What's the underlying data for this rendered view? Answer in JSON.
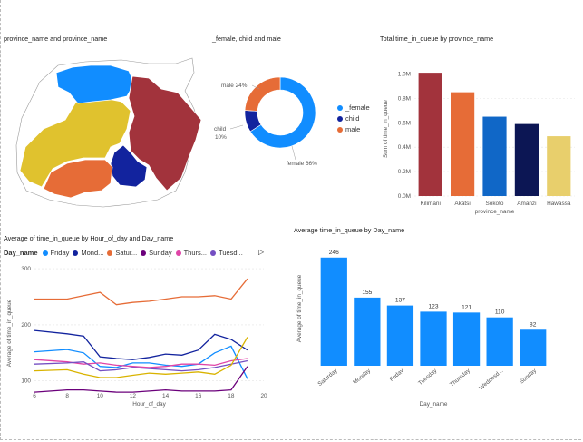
{
  "map": {
    "title": "province_name and province_name",
    "regions": [
      {
        "name": "Sokoto",
        "color": "#118DFF"
      },
      {
        "name": "Kilimani",
        "color": "#A2333C"
      },
      {
        "name": "Akatsi",
        "color": "#E66C37"
      },
      {
        "name": "Amanzi",
        "color": "#12239E"
      },
      {
        "name": "Hawassa",
        "color": "#E0C22E"
      }
    ]
  },
  "donut": {
    "title": "_female, child and male",
    "slices": [
      {
        "name": "_female",
        "value": 66,
        "label": "female 66%",
        "color": "#118DFF"
      },
      {
        "name": "child",
        "value": 10,
        "label": "child",
        "sublabel": "10%",
        "color": "#12239E"
      },
      {
        "name": "male",
        "value": 24,
        "label": "male 24%",
        "color": "#E66C37"
      }
    ],
    "legend": [
      "_female",
      "child",
      "male"
    ]
  },
  "bar_province": {
    "title": "Total time_in_queue by province_name",
    "xlabel": "province_name",
    "ylabel": "Sum of time_in_queue",
    "chart_data": {
      "type": "bar",
      "categories": [
        "Kilimani",
        "Akatsi",
        "Sokoto",
        "Amanzi",
        "Hawassa"
      ],
      "values": [
        1.01,
        0.85,
        0.65,
        0.59,
        0.49
      ],
      "colors": [
        "#A2333C",
        "#E66C37",
        "#1067C7",
        "#0C1654",
        "#E8CF6C"
      ],
      "ticks": [
        "0.0M",
        "0.2M",
        "0.4M",
        "0.6M",
        "0.8M",
        "1.0M"
      ],
      "ylim": [
        0,
        1.1
      ]
    }
  },
  "line_hour": {
    "title": "Average of time_in_queue by Hour_of_day and Day_name",
    "legend_title": "Day_name",
    "legend": [
      {
        "name": "Friday",
        "color": "#118DFF"
      },
      {
        "name": "Mond...",
        "color": "#12239E"
      },
      {
        "name": "Satur...",
        "color": "#E66C37"
      },
      {
        "name": "Sunday",
        "color": "#6B007B"
      },
      {
        "name": "Thurs...",
        "color": "#E044A7"
      },
      {
        "name": "Tuesd...",
        "color": "#744EC2"
      }
    ],
    "xlabel": "Hour_of_day",
    "ylabel": "Average of time_in_queue",
    "xticks": [
      "6",
      "8",
      "10",
      "12",
      "14",
      "16",
      "18",
      "20"
    ],
    "yticks": [
      "100",
      "200",
      "300"
    ],
    "chart_data": {
      "type": "line",
      "x": [
        6,
        8,
        9,
        10,
        11,
        12,
        13,
        14,
        15,
        16,
        17,
        18,
        19
      ],
      "ylim": [
        85,
        305
      ],
      "xlim": [
        6,
        20
      ],
      "series": [
        {
          "name": "Saturday",
          "color": "#E66C37",
          "values": [
            246,
            246,
            252,
            258,
            236,
            240,
            242,
            246,
            250,
            250,
            252,
            246,
            282
          ]
        },
        {
          "name": "Monday",
          "color": "#12239E",
          "values": [
            190,
            184,
            180,
            143,
            140,
            138,
            142,
            148,
            146,
            155,
            183,
            174,
            155
          ]
        },
        {
          "name": "Friday",
          "color": "#118DFF",
          "values": [
            152,
            156,
            150,
            126,
            124,
            132,
            132,
            128,
            126,
            130,
            150,
            162,
            104
          ]
        },
        {
          "name": "Thursday",
          "color": "#E044A7",
          "values": [
            138,
            134,
            130,
            132,
            128,
            126,
            124,
            126,
            130,
            130,
            128,
            136,
            140
          ]
        },
        {
          "name": "Tuesday",
          "color": "#744EC2",
          "values": [
            130,
            132,
            134,
            118,
            120,
            124,
            122,
            120,
            118,
            120,
            124,
            130,
            136
          ]
        },
        {
          "name": "Wednesday",
          "color": "#D9B300",
          "values": [
            118,
            120,
            112,
            106,
            106,
            110,
            114,
            112,
            114,
            116,
            112,
            128,
            178
          ]
        },
        {
          "name": "Sunday",
          "color": "#6B007B",
          "values": [
            80,
            84,
            84,
            82,
            80,
            80,
            82,
            84,
            82,
            82,
            82,
            84,
            126
          ]
        }
      ]
    }
  },
  "bar_day": {
    "title": "Average time_in_queue by Day_name",
    "xlabel": "Day_name",
    "ylabel": "Average of time_in_queue",
    "chart_data": {
      "type": "bar",
      "categories": [
        "Saturday",
        "Monday",
        "Friday",
        "Tuesday",
        "Thursday",
        "Wednesd...",
        "Sunday"
      ],
      "values": [
        246,
        155,
        137,
        123,
        121,
        110,
        82
      ],
      "ylim": [
        0,
        260
      ],
      "color": "#118DFF"
    }
  }
}
